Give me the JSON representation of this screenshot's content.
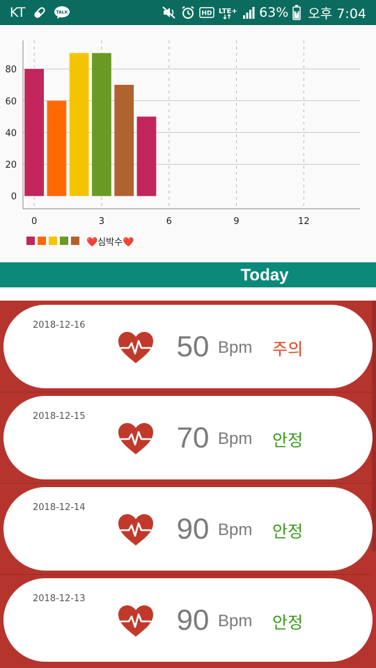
{
  "status_bar": {
    "carrier": "KT",
    "left_icons": [
      "pill-icon",
      "kakaotalk-icon"
    ],
    "kakao_label": "TALK",
    "right_icons": [
      "mute-icon",
      "alarm-icon",
      "hd-icon",
      "lte-icon",
      "signal-icon"
    ],
    "hd_label": "HD",
    "lte_label": "LTE+",
    "battery_percent": "63%",
    "time": "오후 7:04"
  },
  "chart_data": {
    "type": "bar",
    "x": [
      0,
      1,
      2,
      3,
      4,
      5
    ],
    "values": [
      80,
      60,
      90,
      90,
      70,
      50
    ],
    "colors": [
      "#c2255c",
      "#ff6a00",
      "#f5c400",
      "#6a9a23",
      "#b06230",
      "#c2255c"
    ],
    "x_ticks": [
      "0",
      "3",
      "6",
      "9",
      "12"
    ],
    "y_ticks": [
      "0",
      "20",
      "40",
      "60",
      "80"
    ],
    "xlim": [
      -0.5,
      14.5
    ],
    "ylim": [
      -8,
      98
    ],
    "grid": true,
    "legend_label": "❤️심박수❤️",
    "legend_position": "bottom-left"
  },
  "section": {
    "title": "Today"
  },
  "records": [
    {
      "date": "2018-12-16",
      "bpm": "50",
      "unit": "Bpm",
      "status": "주의",
      "status_color": "#e0461f"
    },
    {
      "date": "2018-12-15",
      "bpm": "70",
      "unit": "Bpm",
      "status": "안정",
      "status_color": "#3a9a1c"
    },
    {
      "date": "2018-12-14",
      "bpm": "90",
      "unit": "Bpm",
      "status": "안정",
      "status_color": "#3a9a1c"
    },
    {
      "date": "2018-12-13",
      "bpm": "90",
      "unit": "Bpm",
      "status": "안정",
      "status_color": "#3a9a1c"
    }
  ],
  "colors": {
    "status_bar": "#0b6b5e",
    "header": "#0b8a7a",
    "list_bg": "#b5342d",
    "heart": "#c0392b"
  }
}
